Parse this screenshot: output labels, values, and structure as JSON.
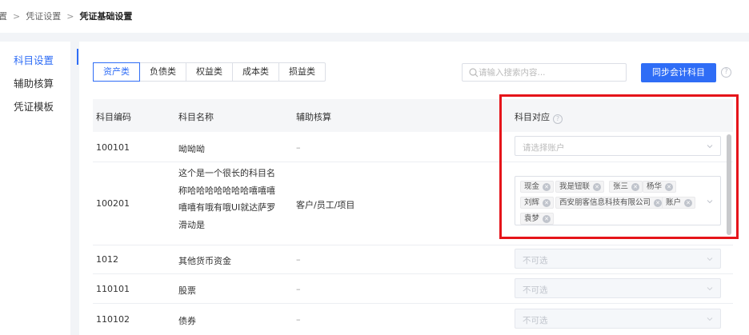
{
  "breadcrumb": {
    "items": [
      "置",
      "凭证设置"
    ],
    "current": "凭证基础设置",
    "separator": ">"
  },
  "sidebar": {
    "items": [
      {
        "label": "科目设置"
      },
      {
        "label": "辅助核算"
      },
      {
        "label": "凭证模板"
      }
    ],
    "active_index": 0
  },
  "tabs": [
    {
      "label": "资产类"
    },
    {
      "label": "负债类"
    },
    {
      "label": "权益类"
    },
    {
      "label": "成本类"
    },
    {
      "label": "损益类"
    }
  ],
  "active_tab": 0,
  "search": {
    "placeholder": "请输入搜索内容...",
    "value": ""
  },
  "sync_button": {
    "label": "同步会计科目"
  },
  "help_icon": "?",
  "table": {
    "columns": [
      "科目编码",
      "科目名称",
      "辅助核算",
      "科目对应"
    ],
    "rows": [
      {
        "code": "100101",
        "name": "呦呦呦",
        "aux": "–",
        "select_placeholder": "请选择账户"
      },
      {
        "code": "100201",
        "name_lines": [
          "这个是一个很长的科目名",
          "称哈哈哈哈哈哈哈嘻嘻嘻",
          "嘻嘻有哦有哦UI就达萨罗",
          "滑动是"
        ],
        "aux": "客户/员工/项目",
        "tags": [
          "现金",
          "我是钮联",
          "张三",
          "杨华",
          "刘辉",
          "西安朋客信息科技有限公司",
          "账户",
          "袁梦"
        ]
      },
      {
        "code": "1012",
        "name": "其他货币资金",
        "aux": "–",
        "select_placeholder": "不可选"
      },
      {
        "code": "110101",
        "name": "股票",
        "aux": "–",
        "select_placeholder": "不可选"
      },
      {
        "code": "110102",
        "name": "债券",
        "aux": "–",
        "select_placeholder": "不可选"
      }
    ]
  },
  "colors": {
    "accent": "#2f6df6",
    "highlight": "#e5141a"
  },
  "icons": {
    "search": "search-icon",
    "help": "help-icon",
    "chevron": "chevron-down-icon",
    "tag_close": "close-icon"
  }
}
